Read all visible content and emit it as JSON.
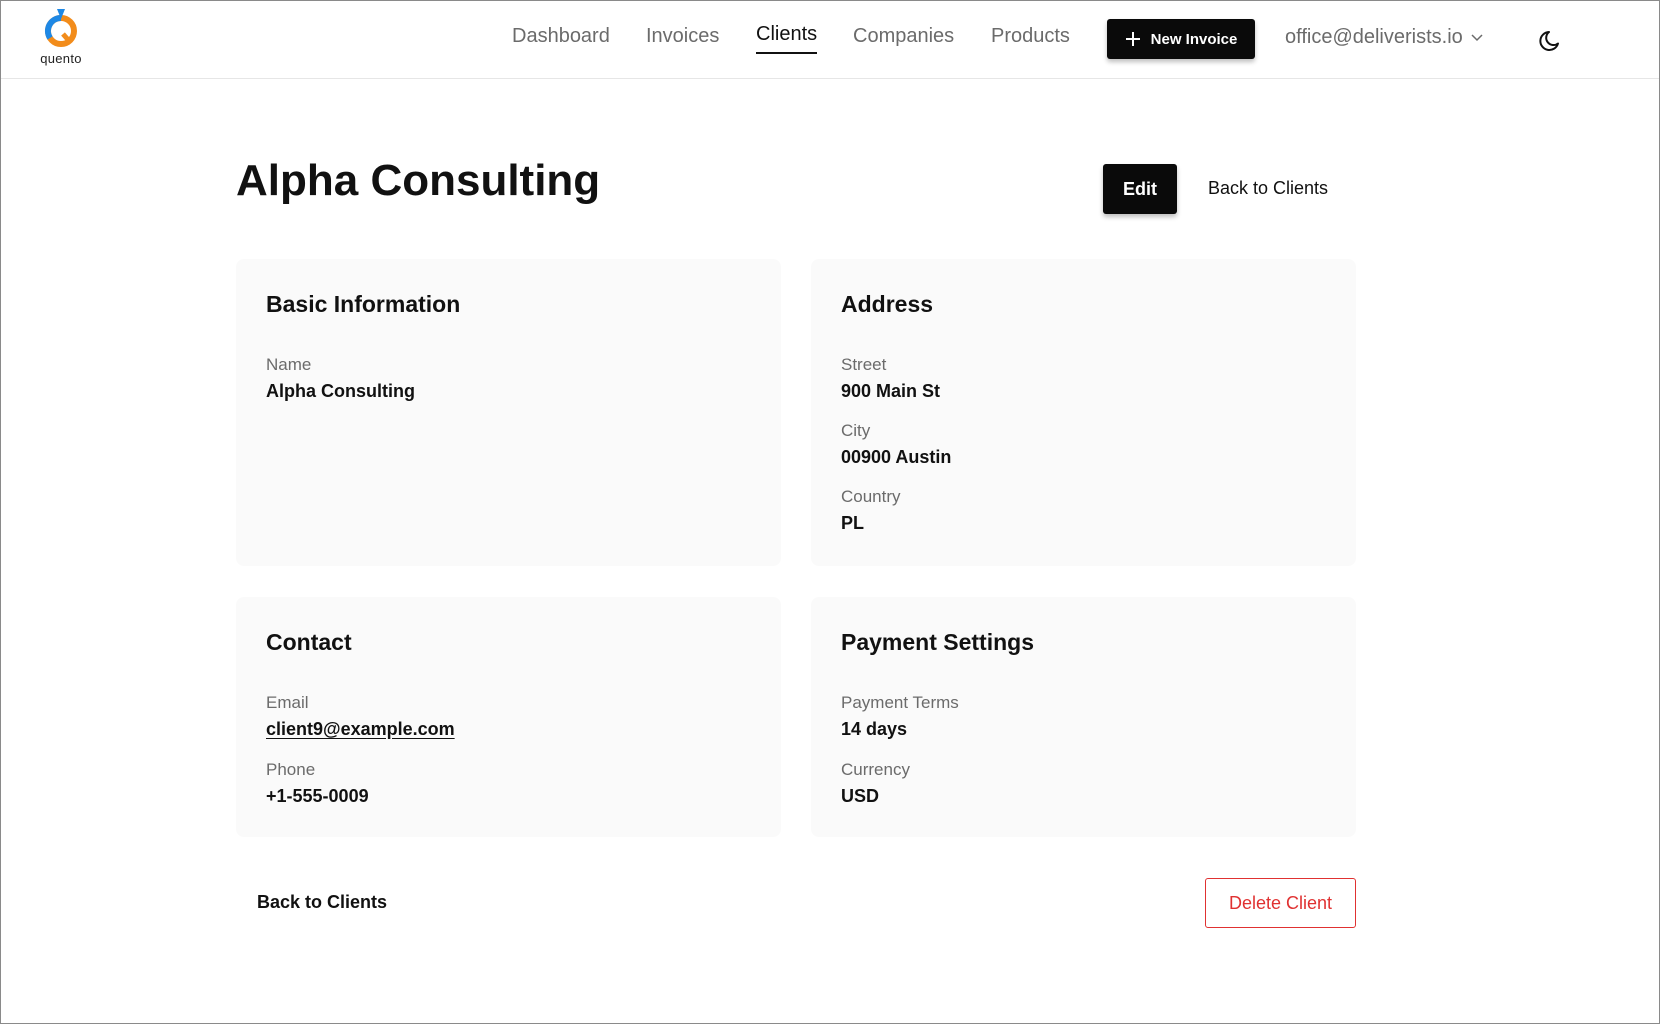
{
  "brand": {
    "logo_text": "quento"
  },
  "nav": {
    "items": [
      {
        "label": "Dashboard"
      },
      {
        "label": "Invoices"
      },
      {
        "label": "Clients"
      },
      {
        "label": "Companies"
      },
      {
        "label": "Products"
      }
    ],
    "active": "Clients",
    "new_invoice_label": "New Invoice",
    "account_email": "office@deliverists.io"
  },
  "page": {
    "title": "Alpha Consulting",
    "edit_label": "Edit",
    "back_label": "Back to Clients",
    "delete_label": "Delete Client"
  },
  "cards": {
    "basic": {
      "title": "Basic Information",
      "fields": [
        {
          "label": "Name",
          "value": "Alpha Consulting"
        }
      ]
    },
    "address": {
      "title": "Address",
      "fields": [
        {
          "label": "Street",
          "value": "900 Main St"
        },
        {
          "label": "City",
          "value": "00900 Austin"
        },
        {
          "label": "Country",
          "value": "PL"
        }
      ]
    },
    "contact": {
      "title": "Contact",
      "fields": [
        {
          "label": "Email",
          "value": "client9@example.com"
        },
        {
          "label": "Phone",
          "value": "+1-555-0009"
        }
      ]
    },
    "payment": {
      "title": "Payment Settings",
      "fields": [
        {
          "label": "Payment Terms",
          "value": "14 days"
        },
        {
          "label": "Currency",
          "value": "USD"
        }
      ]
    }
  },
  "colors": {
    "accent": "#0a0a0a",
    "danger": "#e03131",
    "card_bg": "#fafafa",
    "muted_text": "#6b6b6b"
  },
  "icons": {
    "new_invoice": "plus-icon",
    "account_menu": "chevron-down-icon",
    "theme": "moon-icon"
  }
}
